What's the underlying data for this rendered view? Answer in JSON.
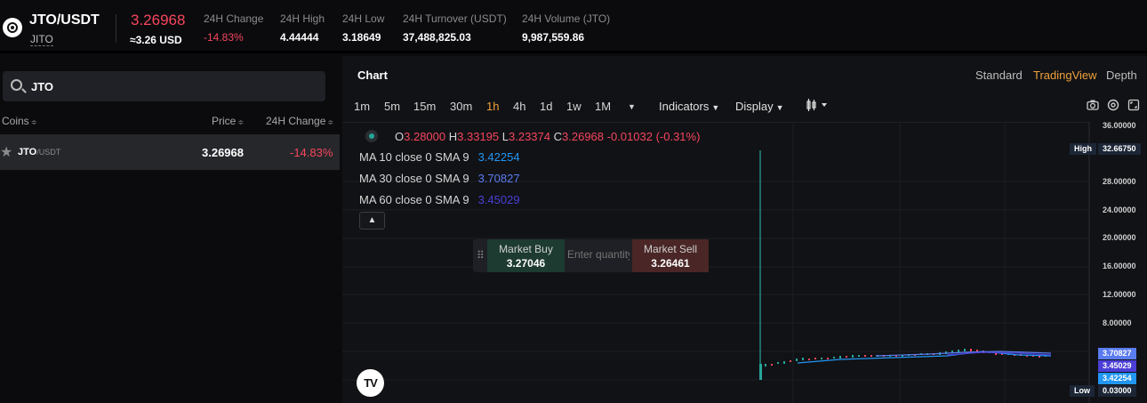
{
  "ticker": {
    "pair": "JTO/USDT",
    "base": "JITO",
    "last_price": "3.26968",
    "usd_price": "≈3.26 USD",
    "stats": [
      {
        "label": "24H Change",
        "value": "-14.83%"
      },
      {
        "label": "24H High",
        "value": "4.44444"
      },
      {
        "label": "24H Low",
        "value": "3.18649"
      },
      {
        "label": "24H Turnover (USDT)",
        "value": "37,488,825.03"
      },
      {
        "label": "24H Volume (JTO)",
        "value": "9,987,559.86"
      }
    ]
  },
  "market_list": {
    "search_value": "JTO",
    "columns": {
      "coins": "Coins",
      "price": "Price",
      "change": "24H Change"
    },
    "sort_glyph": "≑",
    "rows": [
      {
        "symbol": "JTO",
        "quote": "/USDT",
        "price": "3.26968",
        "change": "-14.83%"
      }
    ]
  },
  "chart": {
    "title": "Chart",
    "views": [
      "Standard",
      "TradingView",
      "Depth"
    ],
    "active_view": "TradingView",
    "timeframes": [
      "1m",
      "5m",
      "15m",
      "30m",
      "1h",
      "4h",
      "1d",
      "1w",
      "1M"
    ],
    "active_timeframe": "1h",
    "toolbar": {
      "indicators": "Indicators",
      "display": "Display"
    },
    "ohlc": {
      "o_label": "O",
      "o": "3.28000",
      "h_label": "H",
      "h": "3.33195",
      "l_label": "L",
      "l": "3.23374",
      "c_label": "C",
      "c": "3.26968",
      "change": "-0.01032 (-0.31%)"
    },
    "ma_lines": [
      {
        "label": "MA 10 close 0 SMA 9",
        "value": "3.42254",
        "color": "#2196f3"
      },
      {
        "label": "MA 30 close 0 SMA 9",
        "value": "3.70827",
        "color": "#5b7cf0"
      },
      {
        "label": "MA 60 close 0 SMA 9",
        "value": "3.45029",
        "color": "#4b3fd6"
      }
    ],
    "quick_trade": {
      "buy_label": "Market Buy",
      "buy_price": "3.27046",
      "qty_placeholder": "Enter quantity",
      "sell_label": "Market Sell",
      "sell_price": "3.26461"
    },
    "price_axis": [
      "36.00000",
      "28.00000",
      "24.00000",
      "20.00000",
      "16.00000",
      "12.00000",
      "8.00000"
    ],
    "tags": {
      "high_label": "High",
      "high_value": "32.66750",
      "low_label": "Low",
      "low_value": "0.03000",
      "ma30_value": "3.70827",
      "ma60_value": "3.45029",
      "ma10_value": "3.42254"
    },
    "logo_text": "TV",
    "colors": {
      "up": "#26a69a",
      "down": "#f6465d",
      "accent": "#f0a13b"
    }
  }
}
